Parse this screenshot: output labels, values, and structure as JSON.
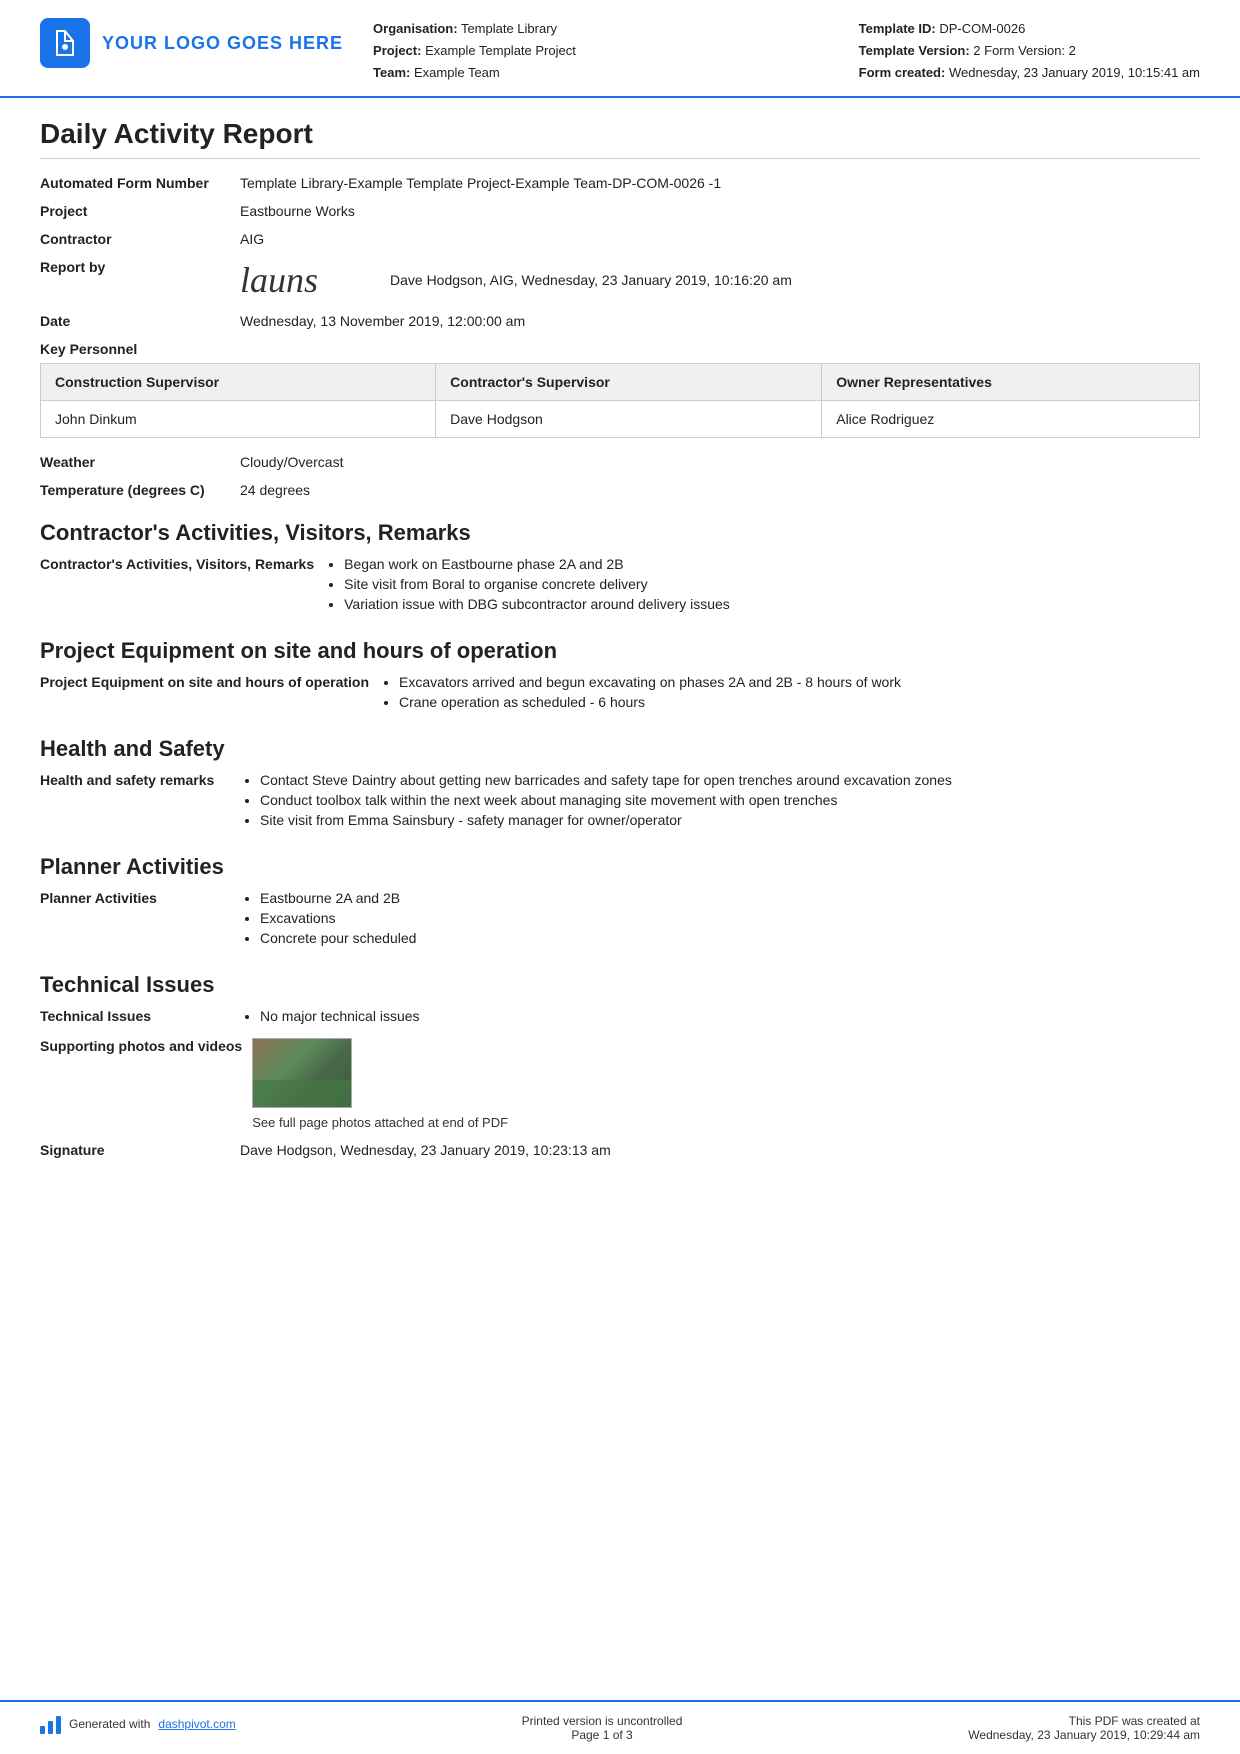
{
  "header": {
    "logo_text": "YOUR LOGO GOES HERE",
    "org_label": "Organisation:",
    "org_value": "Template Library",
    "project_label": "Project:",
    "project_value": "Example Template Project",
    "team_label": "Team:",
    "team_value": "Example Team",
    "template_id_label": "Template ID:",
    "template_id_value": "DP-COM-0026",
    "template_version_label": "Template Version:",
    "template_version_value": "2 Form Version: 2",
    "form_created_label": "Form created:",
    "form_created_value": "Wednesday, 23 January 2019, 10:15:41 am"
  },
  "report": {
    "title": "Daily Activity Report",
    "automated_form_label": "Automated Form Number",
    "automated_form_value": "Template Library-Example Template Project-Example Team-DP-COM-0026   -1",
    "project_label": "Project",
    "project_value": "Eastbourne Works",
    "contractor_label": "Contractor",
    "contractor_value": "AIG",
    "report_by_label": "Report by",
    "report_by_value": "Dave Hodgson, AIG, Wednesday, 23 January 2019, 10:16:20 am",
    "date_label": "Date",
    "date_value": "Wednesday, 13 November 2019, 12:00:00 am"
  },
  "personnel": {
    "section_label": "Key Personnel",
    "columns": [
      "Construction Supervisor",
      "Contractor's Supervisor",
      "Owner Representatives"
    ],
    "rows": [
      [
        "John Dinkum",
        "Dave Hodgson",
        "Alice Rodriguez"
      ]
    ]
  },
  "weather": {
    "label": "Weather",
    "value": "Cloudy/Overcast",
    "temp_label": "Temperature (degrees C)",
    "temp_value": "24 degrees"
  },
  "contractors_activities": {
    "heading": "Contractor's Activities, Visitors, Remarks",
    "label": "Contractor's Activities, Visitors, Remarks",
    "items": [
      "Began work on Eastbourne phase 2A and 2B",
      "Site visit from Boral to organise concrete delivery",
      "Variation issue with DBG subcontractor around delivery issues"
    ]
  },
  "project_equipment": {
    "heading": "Project Equipment on site and hours of operation",
    "label": "Project Equipment on site and hours of operation",
    "items": [
      "Excavators arrived and begun excavating on phases 2A and 2B - 8 hours of work",
      "Crane operation as scheduled - 6 hours"
    ]
  },
  "health_safety": {
    "heading": "Health and Safety",
    "label": "Health and safety remarks",
    "items": [
      "Contact Steve Daintry about getting new barricades and safety tape for open trenches around excavation zones",
      "Conduct toolbox talk within the next week about managing site movement with open trenches",
      "Site visit from Emma Sainsbury - safety manager for owner/operator"
    ]
  },
  "planner_activities": {
    "heading": "Planner Activities",
    "label": "Planner Activities",
    "items": [
      "Eastbourne 2A and 2B",
      "Excavations",
      "Concrete pour scheduled"
    ]
  },
  "technical_issues": {
    "heading": "Technical Issues",
    "label": "Technical Issues",
    "items": [
      "No major technical issues"
    ],
    "photos_label": "Supporting photos and videos",
    "photo_caption": "See full page photos attached at end of PDF",
    "signature_label": "Signature",
    "signature_value": "Dave Hodgson, Wednesday, 23 January 2019, 10:23:13 am"
  },
  "footer": {
    "generated_text": "Generated with ",
    "generated_link": "dashpivot.com",
    "uncontrolled_text": "Printed version is uncontrolled",
    "page_text": "Page 1 of 3",
    "pdf_created_text": "This PDF was created at",
    "pdf_created_value": "Wednesday, 23 January 2019, 10:29:44 am"
  }
}
